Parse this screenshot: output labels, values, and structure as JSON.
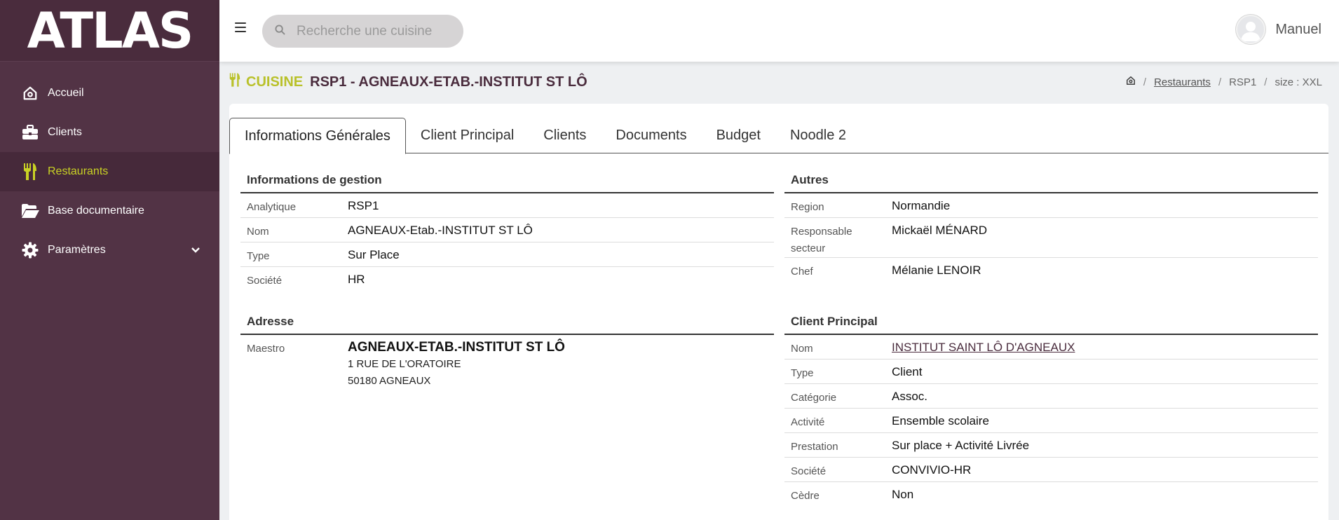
{
  "app": {
    "logo": "ATLAS"
  },
  "sidebar": {
    "items": [
      {
        "label": "Accueil",
        "icon": "home-icon"
      },
      {
        "label": "Clients",
        "icon": "briefcase-icon"
      },
      {
        "label": "Restaurants",
        "icon": "fork-knife-icon",
        "active": true
      },
      {
        "label": "Base documentaire",
        "icon": "folder-open-icon"
      },
      {
        "label": "Paramètres",
        "icon": "gear-icon",
        "has_submenu": true
      }
    ]
  },
  "topbar": {
    "search_placeholder": "Recherche une cuisine",
    "user_name": "Manuel"
  },
  "page": {
    "kind": "CUISINE",
    "title": "RSP1 - AGNEAUX-ETAB.-INSTITUT ST LÔ"
  },
  "breadcrumb": {
    "restaurants": "Restaurants",
    "code": "RSP1",
    "size": "size : XXL"
  },
  "tabs": [
    {
      "label": "Informations Générales",
      "active": true
    },
    {
      "label": "Client Principal"
    },
    {
      "label": "Clients"
    },
    {
      "label": "Documents"
    },
    {
      "label": "Budget"
    },
    {
      "label": "Noodle 2"
    }
  ],
  "gestion": {
    "title": "Informations de gestion",
    "rows": [
      {
        "label": "Analytique",
        "value": "RSP1"
      },
      {
        "label": "Nom",
        "value": "AGNEAUX-Etab.-INSTITUT ST LÔ"
      },
      {
        "label": "Type",
        "value": "Sur Place"
      },
      {
        "label": "Société",
        "value": "HR"
      }
    ]
  },
  "adresse": {
    "title": "Adresse",
    "label": "Maestro",
    "name": "AGNEAUX-ETAB.-INSTITUT ST LÔ",
    "line1": "1 RUE DE L'ORATOIRE",
    "line2": "50180 AGNEAUX"
  },
  "autres": {
    "title": "Autres",
    "rows": [
      {
        "label": "Region",
        "value": "Normandie"
      },
      {
        "label": "Responsable secteur",
        "value": "Mickaël MÉNARD"
      },
      {
        "label": "Chef",
        "value": "Mélanie LENOIR"
      }
    ]
  },
  "client_principal": {
    "title": "Client Principal",
    "rows": [
      {
        "label": "Nom",
        "value": "INSTITUT SAINT LÔ D'AGNEAUX",
        "link": true
      },
      {
        "label": "Type",
        "value": "Client"
      },
      {
        "label": "Catégorie",
        "value": "Assoc."
      },
      {
        "label": "Activité",
        "value": "Ensemble scolaire"
      },
      {
        "label": "Prestation",
        "value": "Sur place + Activité Livrée"
      },
      {
        "label": "Société",
        "value": "CONVIVIO-HR"
      },
      {
        "label": "Cèdre",
        "value": "Non"
      }
    ]
  },
  "colors": {
    "sidebar_bg": "#523345",
    "accent": "#c9d224",
    "title_accent": "#b9c12a"
  }
}
